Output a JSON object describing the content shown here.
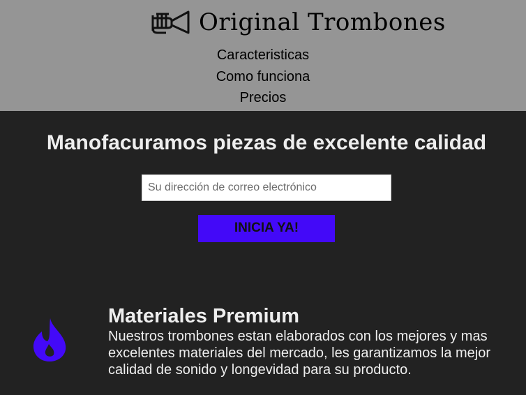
{
  "header": {
    "brand": "Original Trombones",
    "logo_icon": "trumpet-icon"
  },
  "nav": {
    "items": [
      {
        "label": "Caracteristicas"
      },
      {
        "label": "Como funciona"
      },
      {
        "label": "Precios"
      }
    ]
  },
  "hero": {
    "title": "Manofacuramos piezas de excelente calidad",
    "email_placeholder": "Su dirección de correo electrónico",
    "email_value": "",
    "button_label": "INICIA YA!"
  },
  "features": [
    {
      "icon": "fire-icon",
      "title": "Materiales Premium",
      "text": "Nuestros trombones estan elaborados con los mejores y mas excelentes materiales del mercado, les garantizamos la mejor calidad de sonido y longevidad para su producto."
    }
  ],
  "colors": {
    "header_bg": "#959595",
    "page_bg": "#222222",
    "accent": "#4309f8",
    "text_light": "#eeeeee"
  }
}
